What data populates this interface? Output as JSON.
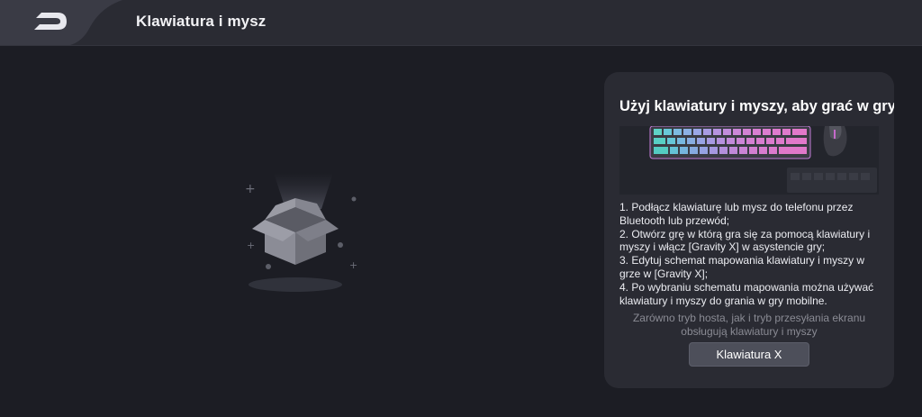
{
  "header": {
    "title": "Klawiatura i mysz",
    "back_icon": "back-logo-icon"
  },
  "empty_state": {
    "icon": "open-box-icon"
  },
  "card": {
    "title": "Użyj klawiatury i myszy, aby grać w gry",
    "image": "keyboard-mouse-illustration",
    "steps": [
      "1. Podłącz klawiaturę lub mysz do telefonu przez Bluetooth lub przewód;",
      "2. Otwórz grę w którą gra się za pomocą klawiatury i myszy i włącz [Gravity X] w asystencie gry;",
      "3. Edytuj schemat mapowania klawiatury i myszy w grze w [Gravity X];",
      "4. Po wybraniu schematu mapowania można używać klawiatury i myszy do grania w gry mobilne."
    ],
    "note": "Zarówno tryb hosta, jak i tryb przesyłania ekranu obsługują klawiatury i myszy",
    "button_label": "Klawiatura X"
  }
}
